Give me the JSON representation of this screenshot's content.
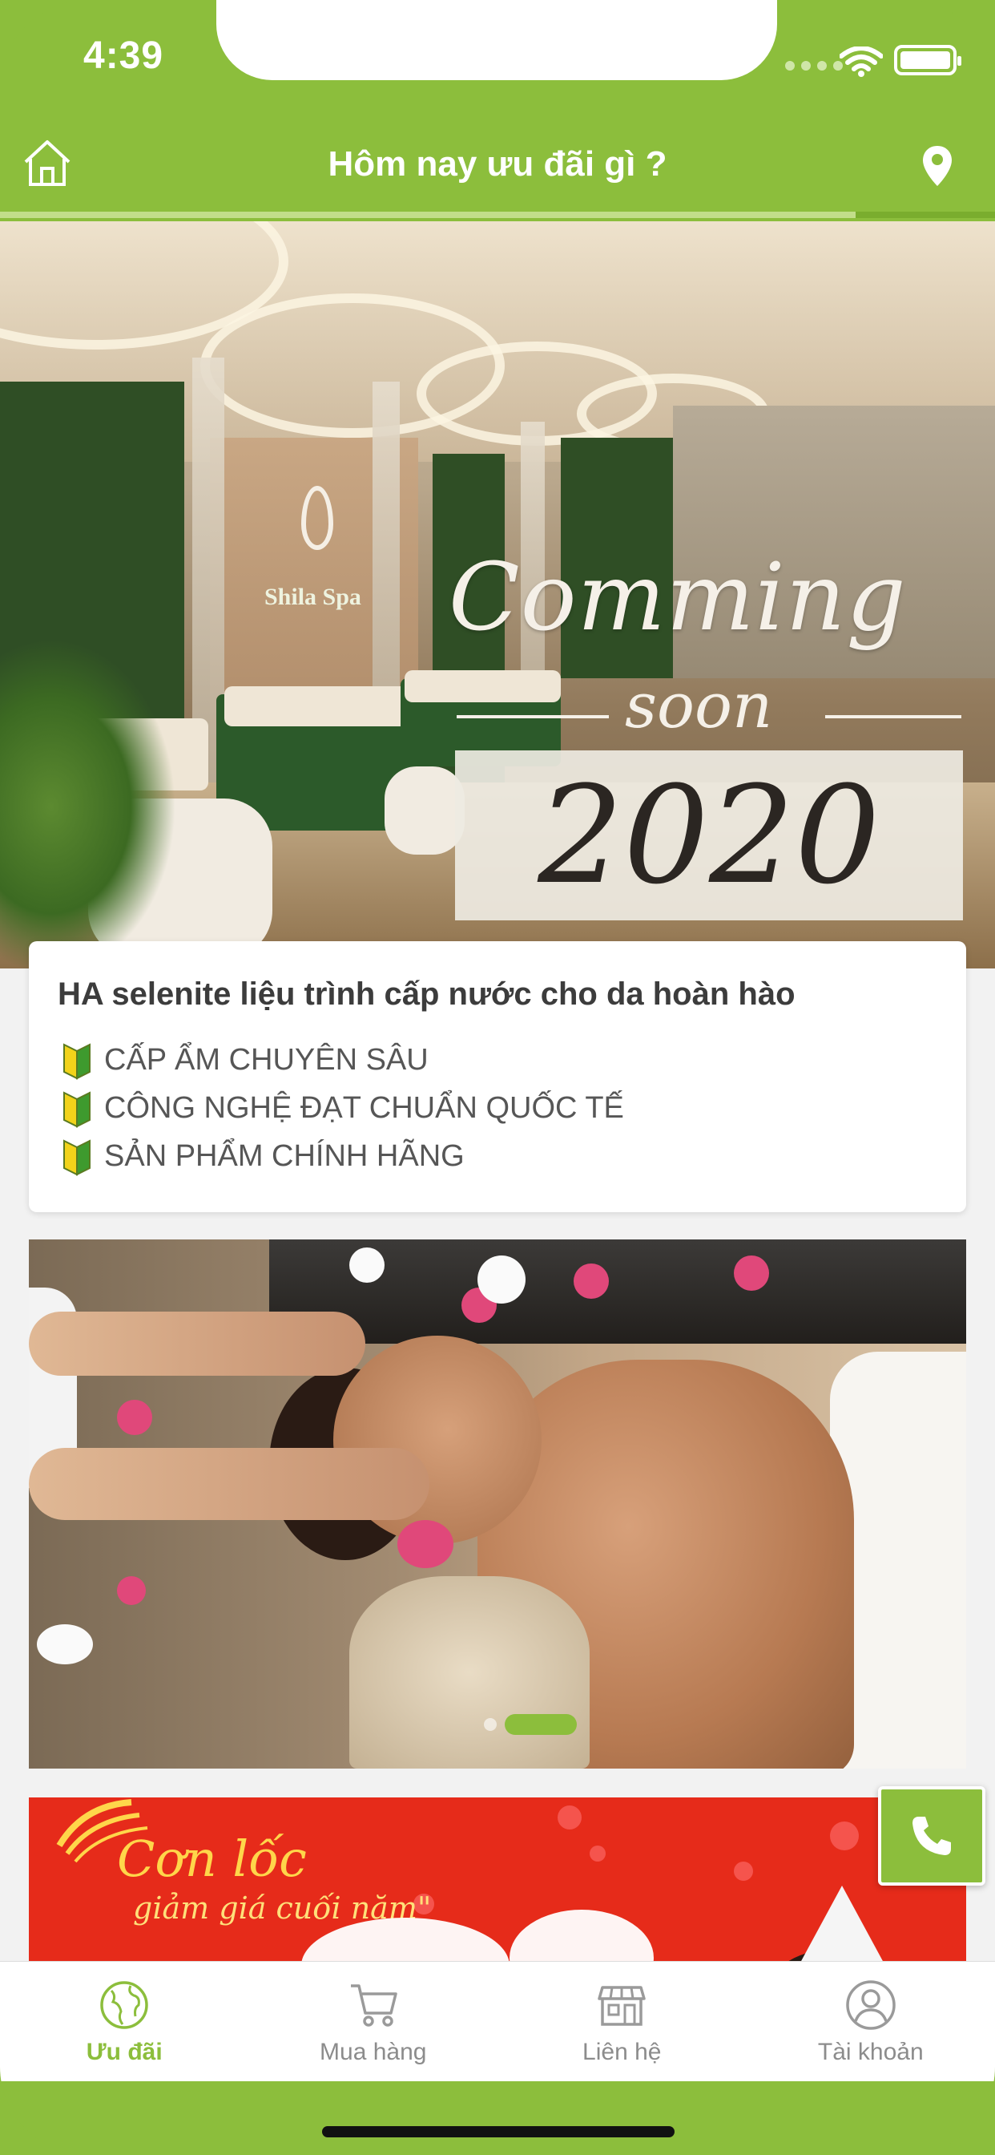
{
  "status_bar": {
    "time": "4:39"
  },
  "nav": {
    "title": "Hôm nay ưu đãi gì ?",
    "progress": 0.86
  },
  "hero": {
    "logo_text": "Shila Spa",
    "line1": "Comming",
    "line2": "soon",
    "year": "2020"
  },
  "promo_card": {
    "title": "HA selenite liệu trình cấp nước cho da hoàn hào",
    "items": [
      {
        "icon": "beginner-leaf-icon",
        "text": "CẤP ẨM CHUYÊN SÂU"
      },
      {
        "icon": "beginner-leaf-icon",
        "text": "CÔNG NGHỆ ĐẠT CHUẨN QUỐC TẾ"
      },
      {
        "icon": "beginner-leaf-icon",
        "text": "SẢN PHẨM CHÍNH HÃNG"
      }
    ]
  },
  "banner": {
    "line1": "Cơn lốc",
    "line2": "giảm giá cuối năm\""
  },
  "tabs": [
    {
      "label": "Ưu đãi",
      "icon": "globe-icon",
      "active": true
    },
    {
      "label": "Mua hàng",
      "icon": "cart-icon",
      "active": false
    },
    {
      "label": "Liên hệ",
      "icon": "store-icon",
      "active": false
    },
    {
      "label": "Tài khoản",
      "icon": "user-icon",
      "active": false
    }
  ],
  "colors": {
    "brand": "#8cbe3c",
    "banner_red": "#e62b1a"
  }
}
